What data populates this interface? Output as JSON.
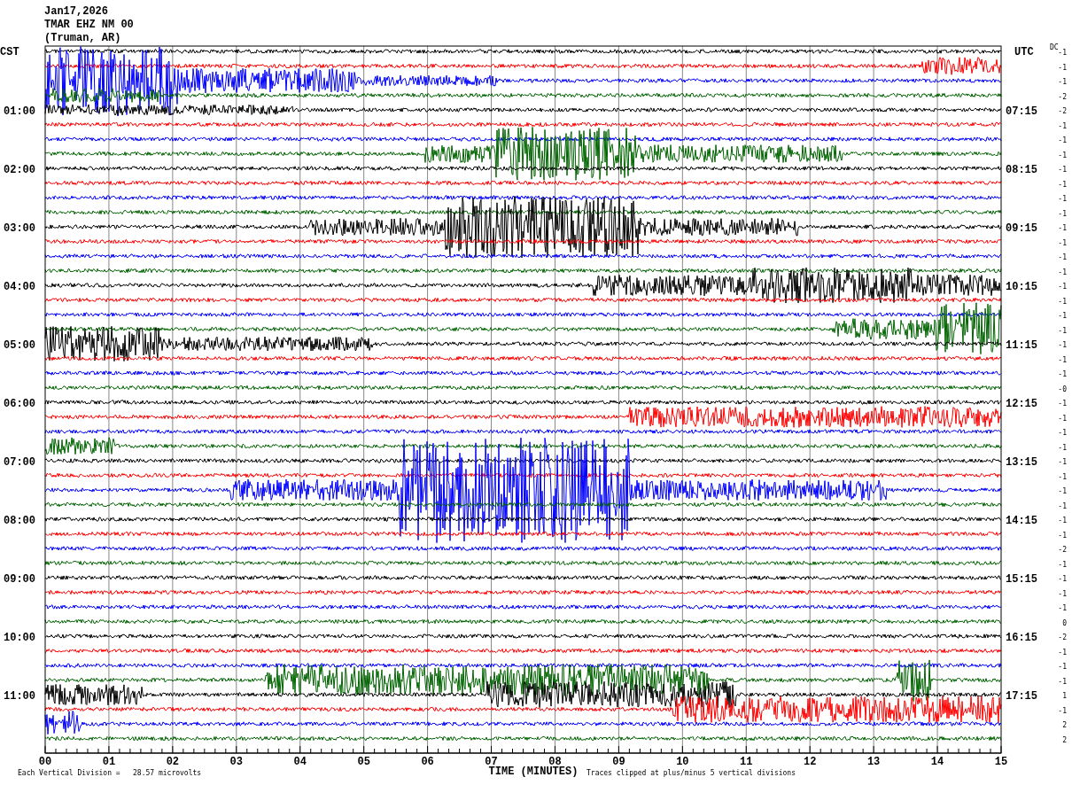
{
  "header": {
    "date": "Jan17,2026",
    "station": "TMAR EHZ NM 00",
    "location": "(Truman, AR)"
  },
  "left_axis": {
    "title": "CST",
    "labels": [
      "01:00",
      "02:00",
      "03:00",
      "04:00",
      "05:00",
      "06:00",
      "07:00",
      "08:00",
      "09:00",
      "10:00",
      "11:00"
    ]
  },
  "right_axis": {
    "title": "UTC",
    "labels": [
      "07:15",
      "08:15",
      "09:15",
      "10:15",
      "11:15",
      "12:15",
      "13:15",
      "14:15",
      "15:15",
      "16:15",
      "17:15"
    ]
  },
  "dc_title": "DC",
  "traces": [
    {
      "color": "#000000",
      "dc": "-1"
    },
    {
      "color": "#ff0000",
      "dc": "-1"
    },
    {
      "color": "#0000ff",
      "dc": "-1"
    },
    {
      "color": "#006400",
      "dc": "-2"
    },
    {
      "color": "#000000",
      "dc": "-2"
    },
    {
      "color": "#ff0000",
      "dc": "-1"
    },
    {
      "color": "#0000ff",
      "dc": "-1"
    },
    {
      "color": "#006400",
      "dc": "-1"
    },
    {
      "color": "#000000",
      "dc": "-1"
    },
    {
      "color": "#ff0000",
      "dc": "-1"
    },
    {
      "color": "#0000ff",
      "dc": "-1"
    },
    {
      "color": "#006400",
      "dc": "-1"
    },
    {
      "color": "#000000",
      "dc": "-1"
    },
    {
      "color": "#ff0000",
      "dc": "-1"
    },
    {
      "color": "#0000ff",
      "dc": "-1"
    },
    {
      "color": "#006400",
      "dc": "-1"
    },
    {
      "color": "#000000",
      "dc": "-1"
    },
    {
      "color": "#ff0000",
      "dc": "-1"
    },
    {
      "color": "#0000ff",
      "dc": "-1"
    },
    {
      "color": "#006400",
      "dc": "-1"
    },
    {
      "color": "#000000",
      "dc": "-1"
    },
    {
      "color": "#ff0000",
      "dc": "-1"
    },
    {
      "color": "#0000ff",
      "dc": "-1"
    },
    {
      "color": "#006400",
      "dc": "-0"
    },
    {
      "color": "#000000",
      "dc": "-1"
    },
    {
      "color": "#ff0000",
      "dc": "-1"
    },
    {
      "color": "#0000ff",
      "dc": "-1"
    },
    {
      "color": "#006400",
      "dc": "-1"
    },
    {
      "color": "#000000",
      "dc": "-1"
    },
    {
      "color": "#ff0000",
      "dc": "-1"
    },
    {
      "color": "#0000ff",
      "dc": "-1"
    },
    {
      "color": "#006400",
      "dc": "-1"
    },
    {
      "color": "#000000",
      "dc": "-1"
    },
    {
      "color": "#ff0000",
      "dc": "-1"
    },
    {
      "color": "#0000ff",
      "dc": "-2"
    },
    {
      "color": "#006400",
      "dc": "-1"
    },
    {
      "color": "#000000",
      "dc": "-1"
    },
    {
      "color": "#ff0000",
      "dc": "-1"
    },
    {
      "color": "#0000ff",
      "dc": "-1"
    },
    {
      "color": "#006400",
      "dc": "0"
    },
    {
      "color": "#000000",
      "dc": "-2"
    },
    {
      "color": "#ff0000",
      "dc": "-1"
    },
    {
      "color": "#0000ff",
      "dc": "-1"
    },
    {
      "color": "#006400",
      "dc": "-1"
    },
    {
      "color": "#000000",
      "dc": "1"
    },
    {
      "color": "#ff0000",
      "dc": "-1"
    },
    {
      "color": "#0000ff",
      "dc": "2"
    },
    {
      "color": "#006400",
      "dc": "2"
    }
  ],
  "x_axis": {
    "ticks": [
      "00",
      "01",
      "02",
      "03",
      "04",
      "05",
      "06",
      "07",
      "08",
      "09",
      "10",
      "11",
      "12",
      "13",
      "14",
      "15"
    ],
    "title": "TIME (MINUTES)"
  },
  "footer": {
    "scale_note": "Each Vertical Division =   28.57 microvolts",
    "clip_note": "Traces clipped at plus/minus 5 vertical divisions"
  }
}
